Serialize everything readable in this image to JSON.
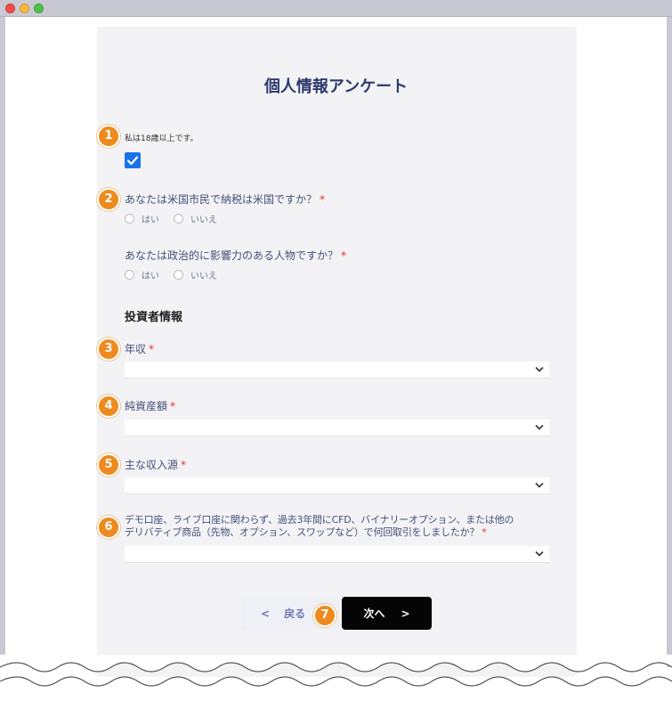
{
  "window": {
    "controls": [
      "close",
      "minimize",
      "maximize"
    ]
  },
  "form": {
    "title": "個人情報アンケート",
    "q1": {
      "label": "私は18歳以上です。",
      "checked": true
    },
    "q2": {
      "label": "あなたは米国市民で納税は米国ですか？",
      "required": "*",
      "options": [
        "はい",
        "いいえ"
      ]
    },
    "q2b": {
      "label": "あなたは政治的に影響力のある人物ですか？",
      "required": "*",
      "options": [
        "はい",
        "いいえ"
      ]
    },
    "section": "投資者情報",
    "q3": {
      "label": "年収",
      "required": "*",
      "value": ""
    },
    "q4": {
      "label": "純資産額",
      "required": "*",
      "value": ""
    },
    "q5": {
      "label": "主な収入源",
      "required": "*",
      "value": ""
    },
    "q6": {
      "label_line1": "デモ口座、ライブ口座に関わらず、過去3年間にCFD、バイナリーオプション、または他の",
      "label_line2": "デリバティブ商品（先物、オプション、スワップなど）で何回取引をしましたか？",
      "required": "*",
      "value": ""
    },
    "buttons": {
      "back_arrow": "<",
      "back": "戻る",
      "next": "次へ",
      "next_arrow": ">"
    }
  },
  "badges": [
    "1",
    "2",
    "3",
    "4",
    "5",
    "6",
    "7"
  ],
  "colors": {
    "badge": "#ee8a1e",
    "accent": "#1a73e8",
    "title": "#2e3a6e",
    "required": "#e0322c"
  },
  "icons": {
    "checkbox": "checkmark-icon",
    "select": "chevron-down-icon"
  }
}
